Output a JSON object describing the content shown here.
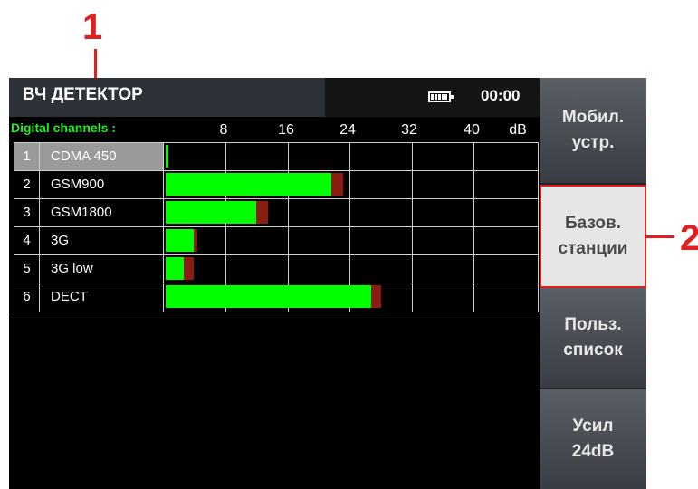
{
  "callouts": {
    "one": "1",
    "two": "2"
  },
  "header": {
    "title": "ВЧ ДЕТЕКТОР",
    "clock": "00:00",
    "battery_icon": "battery-full-icon"
  },
  "channels": {
    "label": "Digital channels :",
    "scale": [
      "8",
      "16",
      "24",
      "32",
      "40",
      "dB"
    ],
    "rows": [
      {
        "num": "1",
        "name": "CDMA 450",
        "level_db": 0.3,
        "peak_db": 0.3,
        "selected": true
      },
      {
        "num": "2",
        "name": "GSM900",
        "level_db": 21.4,
        "peak_db": 22.9,
        "selected": false
      },
      {
        "num": "3",
        "name": "GSM1800",
        "level_db": 11.7,
        "peak_db": 13.2,
        "selected": false
      },
      {
        "num": "4",
        "name": "3G",
        "level_db": 3.6,
        "peak_db": 4.1,
        "selected": false
      },
      {
        "num": "5",
        "name": "3G  low",
        "level_db": 2.3,
        "peak_db": 3.6,
        "selected": false
      },
      {
        "num": "6",
        "name": "DECT",
        "level_db": 26.6,
        "peak_db": 27.9,
        "selected": false
      }
    ]
  },
  "menu": {
    "mobile": [
      "Мобил.",
      "устр."
    ],
    "base_stations": [
      "Базов.",
      "станции"
    ],
    "user_list": [
      "Польз.",
      "список"
    ],
    "gain": [
      "Усил",
      "24dB"
    ]
  },
  "colors": {
    "level": "#00ff00",
    "peak": "#8a1c10",
    "callout": "#e02020"
  }
}
